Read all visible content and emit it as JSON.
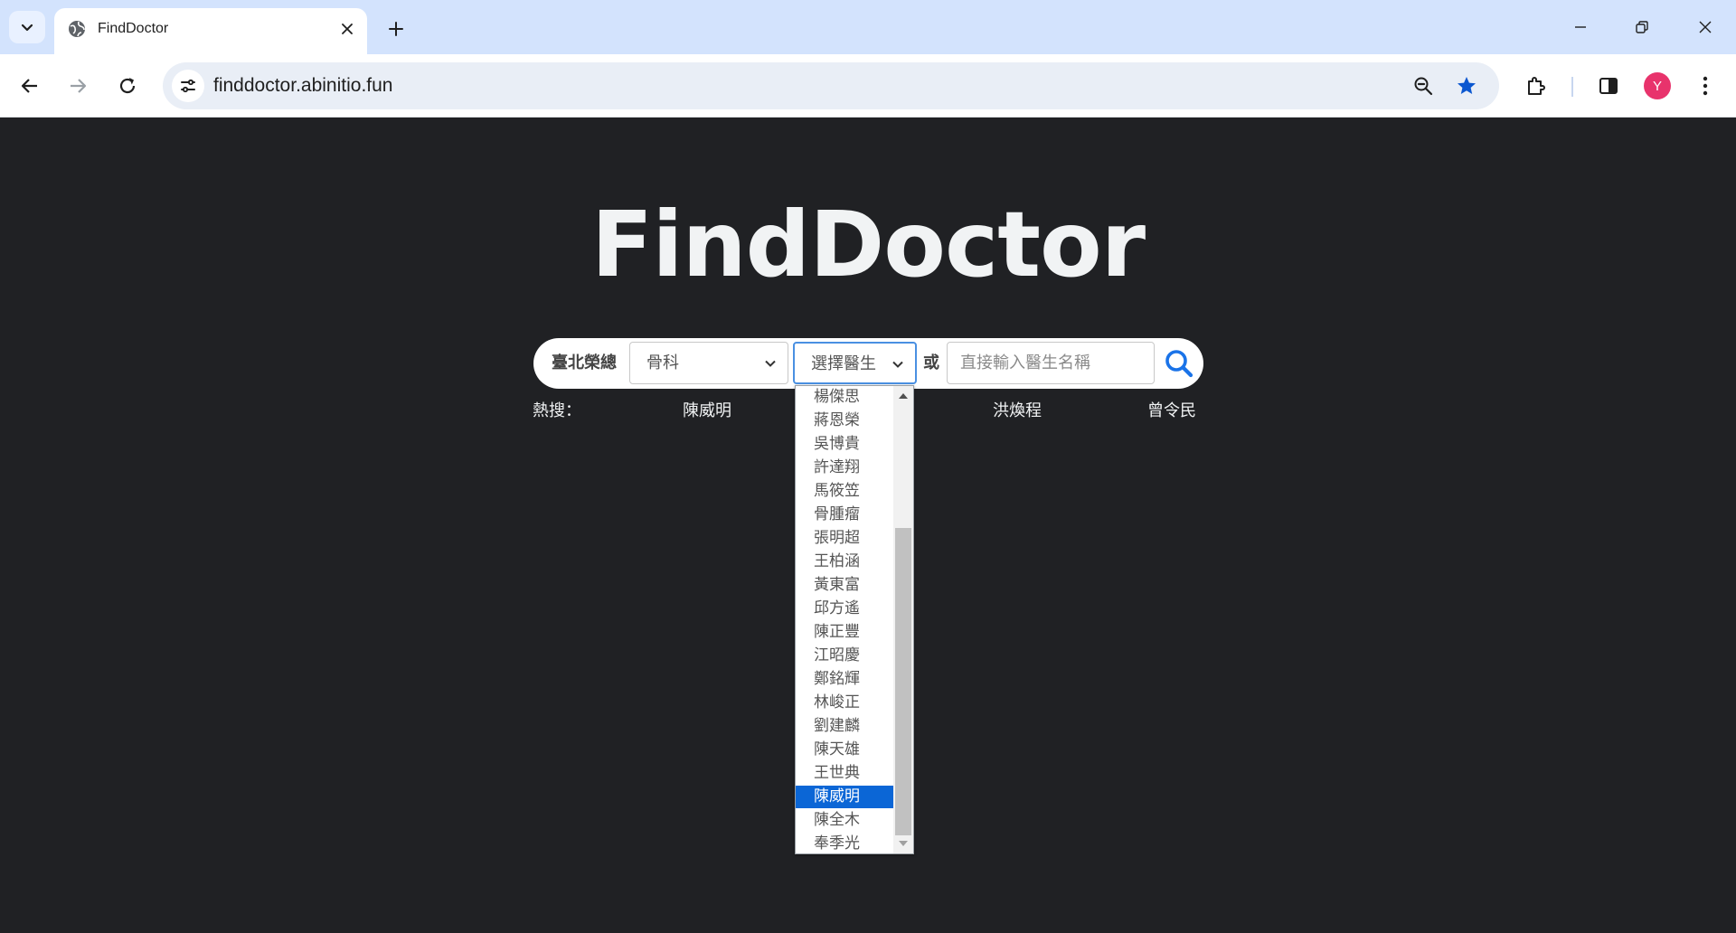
{
  "browser": {
    "tab_title": "FindDoctor",
    "url": "finddoctor.abinitio.fun",
    "profile_initial": "Y"
  },
  "page": {
    "logo": "FindDoctor",
    "hospital": "臺北榮總",
    "department_value": "骨科",
    "doctor_select_value": "選擇醫生",
    "or_label": "或",
    "name_input_placeholder": "直接輸入醫生名稱",
    "hot_label": "熱搜：",
    "hot_items": [
      "陳威明",
      "洪煥程",
      "曾令民"
    ]
  },
  "dropdown": {
    "options": [
      "楊傑思",
      "蔣恩榮",
      "吳博貴",
      "許達翔",
      "馬筱笠",
      "骨腫瘤",
      "張明超",
      "王柏涵",
      "黃東富",
      "邱方遙",
      "陳正豐",
      "江昭慶",
      "鄭銘輝",
      "林峻正",
      "劉建麟",
      "陳天雄",
      "王世典",
      "陳威明",
      "陳全木",
      "奉季光"
    ],
    "selected": "陳威明"
  },
  "colors": {
    "accent": "#0b66d6",
    "background": "#202124",
    "search_icon": "#1a73e8",
    "bookmark_star": "#0b57d0"
  }
}
